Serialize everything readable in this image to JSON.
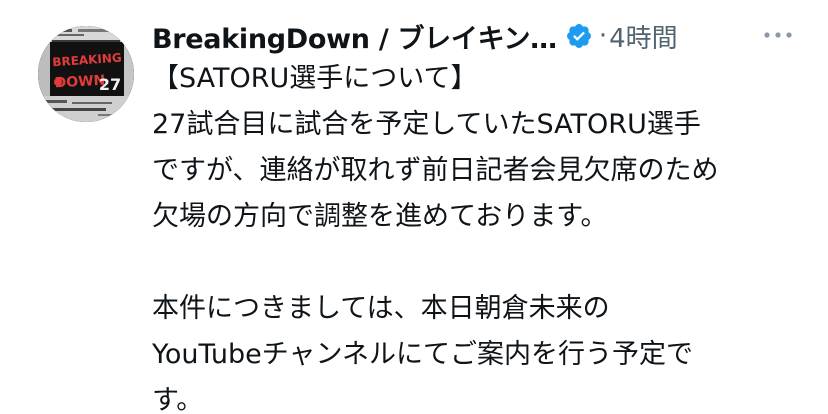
{
  "tweet": {
    "author_name": "BreakingDown / ブレイキン…",
    "separator": "·",
    "time": "4時間",
    "verified_color": "#1d9bf0",
    "avatar_icon": "breakingdown-logo-avatar",
    "avatar_logo_lines": [
      "BREAKING",
      "DOWN",
      "27"
    ],
    "body_lines": [
      "【SATORU選手について】",
      "27試合目に試合を予定していたSATORU選手",
      "ですが、連絡が取れず前日記者会見欠席のため",
      "欠場の方向で調整を進めております。",
      "",
      "本件につきましては、本日朝倉未来の",
      "YouTubeチャンネルにてご案内を行う予定で",
      "す。"
    ],
    "more_icon": "more-horizontal-icon"
  }
}
